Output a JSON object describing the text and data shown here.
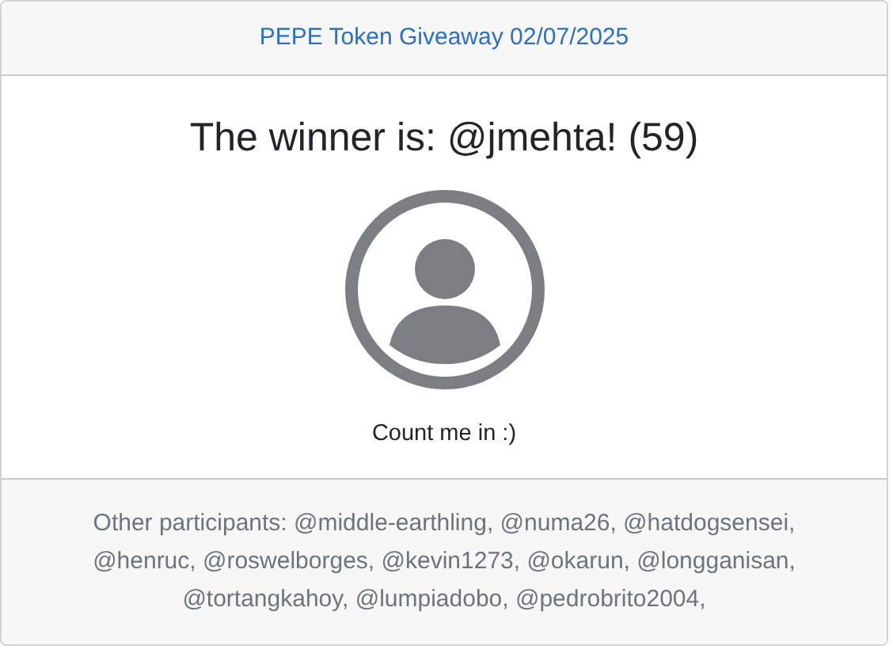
{
  "header": {
    "link": "PEPE Token Giveaway 02/07/2025"
  },
  "winner": {
    "title": "The winner is: @jmehta! (59)",
    "comment": "Count me in :)"
  },
  "footer": {
    "text": "Other participants: @middle-earthling, @numa26, @hatdogsensei, @henruc, @roswelborges, @kevin1273, @okarun, @longganisan, @tortangkahoy, @lumpiadobo, @pedrobrito2004,"
  }
}
